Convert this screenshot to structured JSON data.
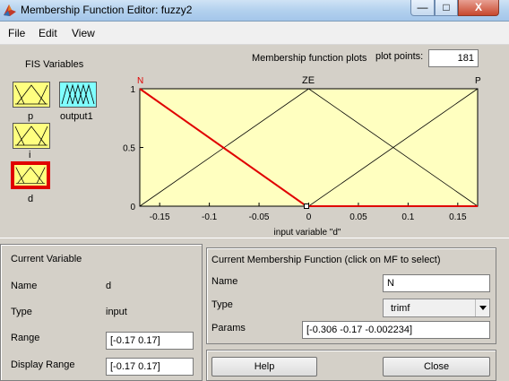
{
  "window": {
    "title": "Membership Function Editor: fuzzy2",
    "min_symbol": "—",
    "max_symbol": "□",
    "close_symbol": "X"
  },
  "menu": [
    "File",
    "Edit",
    "View"
  ],
  "fis": {
    "label": "FIS Variables",
    "variables": [
      {
        "name": "p",
        "kind": "input"
      },
      {
        "name": "output1",
        "kind": "output"
      },
      {
        "name": "i",
        "kind": "input"
      },
      {
        "name": "d",
        "kind": "input",
        "selected": true
      }
    ]
  },
  "plot": {
    "title": "Membership function plots",
    "plot_points_label": "plot points:",
    "plot_points": "181",
    "mf_names": [
      "N",
      "ZE",
      "P"
    ],
    "xlabel": "input variable \"d\"",
    "xticks": [
      "-0.15",
      "-0.1",
      "-0.05",
      "0",
      "0.05",
      "0.1",
      "0.15"
    ],
    "yticks": [
      "0",
      "0.5",
      "1"
    ]
  },
  "chart_data": {
    "type": "line",
    "xlim": [
      -0.17,
      0.17
    ],
    "ylim": [
      0,
      1
    ],
    "xlabel": "input variable \"d\"",
    "ylabel": "",
    "series": [
      {
        "name": "N",
        "highlight": true,
        "x": [
          -0.17,
          -0.002234,
          0.17
        ],
        "y": [
          1,
          0,
          0
        ]
      },
      {
        "name": "ZE",
        "x": [
          -0.17,
          0,
          0.17
        ],
        "y": [
          0,
          1,
          0
        ]
      },
      {
        "name": "P",
        "x": [
          -0.17,
          0,
          0.17
        ],
        "y": [
          0,
          0,
          1
        ]
      }
    ],
    "colors": {
      "background": "#ffffc0",
      "line": "#000000",
      "selected": "#e00000"
    }
  },
  "current_variable": {
    "title": "Current Variable",
    "name_label": "Name",
    "name": "d",
    "type_label": "Type",
    "type": "input",
    "range_label": "Range",
    "range": "[-0.17 0.17]",
    "display_range_label": "Display Range",
    "display_range": "[-0.17 0.17]"
  },
  "current_mf": {
    "title": "Current Membership Function (click on MF to select)",
    "name_label": "Name",
    "name": "N",
    "type_label": "Type",
    "type": "trimf",
    "params_label": "Params",
    "params": "[-0.306 -0.17 -0.002234]"
  },
  "buttons": {
    "help": "Help",
    "close": "Close"
  }
}
